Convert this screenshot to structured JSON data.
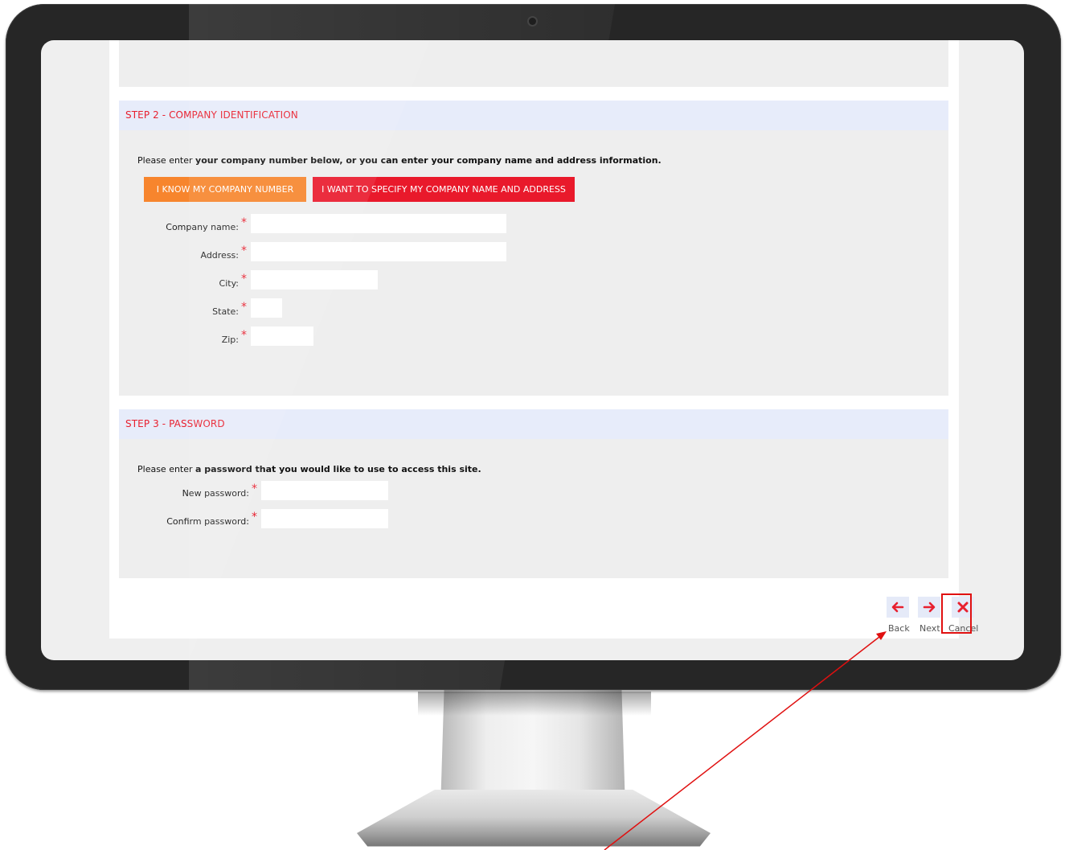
{
  "step2": {
    "header": "STEP 2 - COMPANY IDENTIFICATION",
    "intro_plain": "Please enter ",
    "intro_bold": "your company number below, or you can enter your company name and address information.",
    "btn_company_number": "I KNOW MY COMPANY NUMBER",
    "btn_name_address": "I WANT TO SPECIFY MY COMPANY NAME AND ADDRESS",
    "fields": {
      "company_name": {
        "label": "Company name:",
        "value": ""
      },
      "address": {
        "label": "Address:",
        "value": ""
      },
      "city": {
        "label": "City:",
        "value": ""
      },
      "state": {
        "label": "State:",
        "value": ""
      },
      "zip": {
        "label": "Zip:",
        "value": ""
      }
    }
  },
  "step3": {
    "header": "STEP 3 - PASSWORD",
    "intro_plain": "Please enter ",
    "intro_bold": "a password that you would like to use to access this site.",
    "fields": {
      "new_password": {
        "label": "New password:",
        "value": ""
      },
      "confirm_password": {
        "label": "Confirm password:",
        "value": ""
      }
    }
  },
  "required_marker": "*",
  "nav": {
    "back_label": "Back",
    "next_label": "Next",
    "cancel_label": "Cancel",
    "back_icon": "arrow-left-icon",
    "next_icon": "arrow-right-icon",
    "cancel_icon": "close-x-icon"
  },
  "colors": {
    "accent_red": "#e8202f",
    "orange": "#f7852d",
    "header_bg": "#e7ecfa",
    "panel_bg": "#eeeeee",
    "annotation": "#e01010"
  }
}
